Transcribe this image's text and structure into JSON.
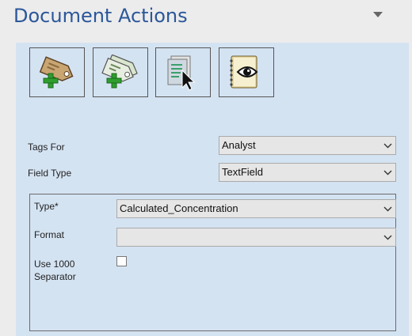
{
  "panel": {
    "title": "Document Actions"
  },
  "toolbar": {
    "buttons": [
      {
        "icon": "add-tag-icon"
      },
      {
        "icon": "add-multiple-tags-icon"
      },
      {
        "icon": "select-document-icon"
      },
      {
        "icon": "view-notebook-icon"
      }
    ]
  },
  "form": {
    "tags_for": {
      "label": "Tags For",
      "value": "Analyst"
    },
    "field_type": {
      "label": "Field Type",
      "value": "TextField"
    }
  },
  "group": {
    "type": {
      "label": "Type*",
      "value": "Calculated_Concentration"
    },
    "format": {
      "label": "Format",
      "value": ""
    },
    "separator": {
      "label_line1": "Use 1000",
      "label_line2": "Separator",
      "checked": false
    }
  },
  "colors": {
    "title": "#2b579a",
    "content_bg": "#d4e3f2",
    "panel_bg": "#ececec",
    "select_bg": "#e6e6e6"
  }
}
